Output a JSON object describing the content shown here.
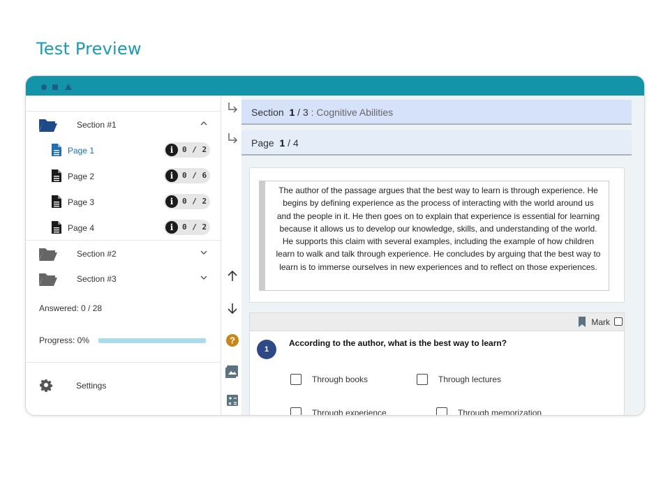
{
  "page": {
    "heading": "Test Preview"
  },
  "colors": {
    "accent": "#1394a8",
    "active_link": "#1f6fb2",
    "question_badge": "#2d4a86",
    "help_icon": "#c7861a"
  },
  "sidebar": {
    "sections": [
      {
        "label": "Section #1",
        "expanded": true,
        "chevron": "chevron-up-icon"
      },
      {
        "label": "Section #2",
        "expanded": false,
        "chevron": "chevron-down-icon"
      },
      {
        "label": "Section #3",
        "expanded": false,
        "chevron": "chevron-down-icon"
      }
    ],
    "pages": [
      {
        "label": "Page 1",
        "count": "0 / 2",
        "active": true
      },
      {
        "label": "Page 2",
        "count": "0 / 6",
        "active": false
      },
      {
        "label": "Page 3",
        "count": "0 / 2",
        "active": false
      },
      {
        "label": "Page 4",
        "count": "0 / 2",
        "active": false
      }
    ],
    "answered": "Answered: 0 / 28",
    "progress_label": "Progress: 0%",
    "progress_value": 0,
    "settings_label": "Settings"
  },
  "toolstrip": {
    "icons": [
      "return-arrow-icon",
      "return-arrow-icon",
      "arrow-up-icon",
      "arrow-down-icon",
      "help-icon",
      "image-icon",
      "calculator-icon"
    ]
  },
  "main": {
    "section_header": {
      "prefix": "Section",
      "current": "1",
      "total": "/ 3",
      "name": ": Cognitive Abilities"
    },
    "page_header": {
      "prefix": "Page",
      "current": "1",
      "total": "/ 4"
    },
    "passage": "The author of the passage argues that the best way to learn is through experience. He begins by defining experience as the process of interacting with the world around us and the people in it. He then goes on to explain that experience is essential for learning because it allows us to develop our knowledge, skills, and understanding of the world. He supports this claim with several examples, including the example of how children learn to walk and talk through experience. He concludes by arguing that the best way to learn is to immerse ourselves in new experiences and to reflect on those experiences.",
    "question": {
      "number": "1",
      "text": "According to the author, what is the best way to learn?",
      "mark_label": "Mark",
      "options": [
        "Through books",
        "Through lectures",
        "Through experience",
        "Through memorization"
      ]
    }
  }
}
